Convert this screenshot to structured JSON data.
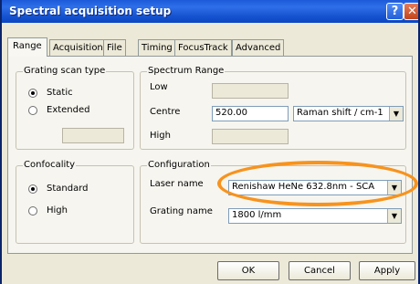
{
  "window": {
    "title": "Spectral acquisition setup",
    "help_label": "?",
    "close_label": "✕"
  },
  "tabs": [
    {
      "label": "Range",
      "active": true
    },
    {
      "label": "Acquisition",
      "active": false
    },
    {
      "label": "File",
      "active": false
    },
    {
      "label": "Timing",
      "active": false
    },
    {
      "label": "FocusTrack",
      "active": false
    },
    {
      "label": "Advanced",
      "active": false
    }
  ],
  "grating_scan": {
    "legend": "Grating scan type",
    "static_label": "Static",
    "static_checked": true,
    "extended_label": "Extended",
    "extended_checked": false,
    "value": ""
  },
  "spectrum_range": {
    "legend": "Spectrum Range",
    "low_label": "Low",
    "low_value": "",
    "centre_label": "Centre",
    "centre_value": "520.00",
    "units_selected": "Raman shift / cm-1",
    "high_label": "High",
    "high_value": ""
  },
  "confocality": {
    "legend": "Confocality",
    "standard_label": "Standard",
    "standard_checked": true,
    "high_label": "High",
    "high_checked": false
  },
  "configuration": {
    "legend": "Configuration",
    "laser_label": "Laser name",
    "laser_selected": "Renishaw HeNe 632.8nm - SCA",
    "grating_label": "Grating name",
    "grating_selected": "1800 l/mm"
  },
  "buttons": {
    "ok": "OK",
    "cancel": "Cancel",
    "apply": "Apply"
  },
  "highlight_color": "#f7931e"
}
